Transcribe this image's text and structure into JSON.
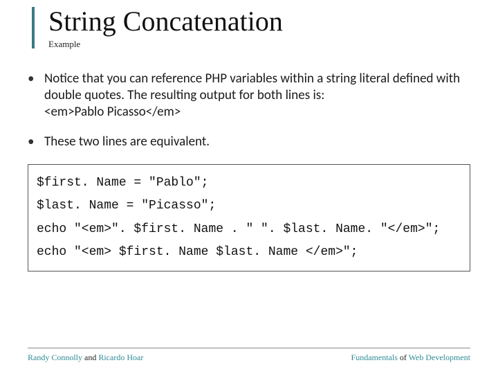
{
  "header": {
    "title": "String Concatenation",
    "subtitle": "Example"
  },
  "bullets": {
    "b1_pre": "Notice that you can reference PHP variables within a string literal defined with double quotes. The resulting output for both lines is:",
    "b1_out": "<em>Pablo Picasso</em>",
    "b2": "These two lines are equivalent."
  },
  "code": {
    "l1": "$first. Name = \"Pablo\";",
    "l2": "$last. Name = \"Picasso\";",
    "l3": "echo \"<em>\". $first. Name . \" \". $last. Name. \"</em>\";",
    "l4": "echo \"<em> $first. Name $last. Name </em>\";"
  },
  "footer": {
    "left_a": "Randy Connolly",
    "left_mid": " and ",
    "left_b": "Ricardo Hoar",
    "right_a": "Fundamentals",
    "right_mid": " of ",
    "right_b": "Web Development"
  }
}
